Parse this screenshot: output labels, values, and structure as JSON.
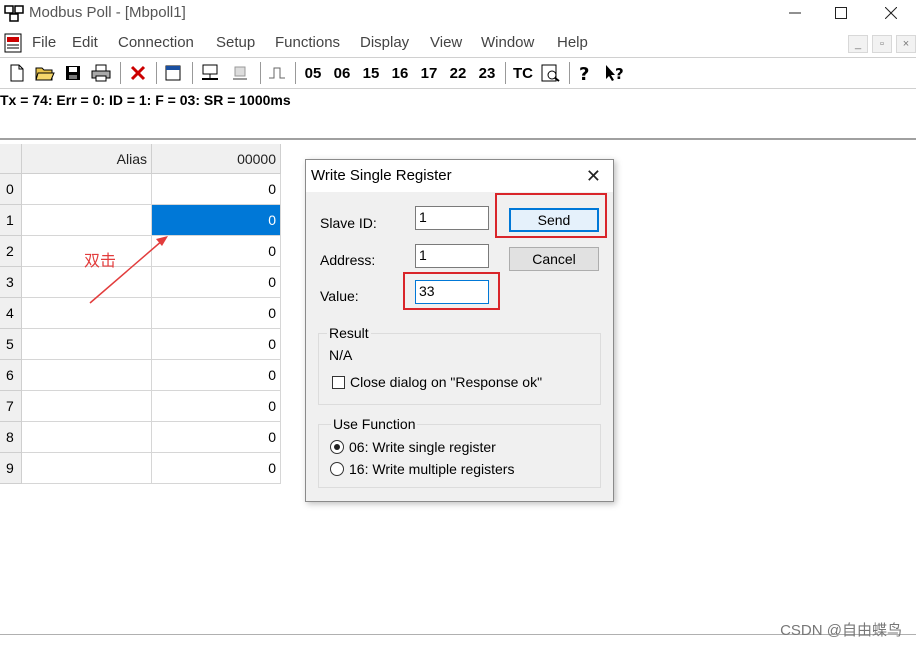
{
  "window": {
    "title": "Modbus Poll - [Mbpoll1]"
  },
  "menu": [
    "File",
    "Edit",
    "Connection",
    "Setup",
    "Functions",
    "Display",
    "View",
    "Window",
    "Help"
  ],
  "toolbar": {
    "function_codes": [
      "05",
      "06",
      "15",
      "16",
      "17",
      "22",
      "23"
    ],
    "tc_label": "TC"
  },
  "status_line": "Tx = 74: Err = 0: ID = 1: F = 03: SR = 1000ms",
  "grid": {
    "headers": {
      "alias": "Alias",
      "address": "00000"
    },
    "rows": [
      {
        "index": "0",
        "alias": "",
        "value": "0"
      },
      {
        "index": "1",
        "alias": "",
        "value": "0"
      },
      {
        "index": "2",
        "alias": "",
        "value": "0"
      },
      {
        "index": "3",
        "alias": "",
        "value": "0"
      },
      {
        "index": "4",
        "alias": "",
        "value": "0"
      },
      {
        "index": "5",
        "alias": "",
        "value": "0"
      },
      {
        "index": "6",
        "alias": "",
        "value": "0"
      },
      {
        "index": "7",
        "alias": "",
        "value": "0"
      },
      {
        "index": "8",
        "alias": "",
        "value": "0"
      },
      {
        "index": "9",
        "alias": "",
        "value": "0"
      }
    ],
    "selected_row": 1
  },
  "annotation": {
    "text": "双击"
  },
  "dialog": {
    "title": "Write Single Register",
    "slave_id_label": "Slave ID:",
    "slave_id_value": "1",
    "address_label": "Address:",
    "address_value": "1",
    "value_label": "Value:",
    "value_value": "33",
    "send_label": "Send",
    "cancel_label": "Cancel",
    "result_title": "Result",
    "result_value": "N/A",
    "close_on_ok_label": "Close dialog on \"Response ok\"",
    "use_function_title": "Use Function",
    "option_06": "06: Write single register",
    "option_16": "16: Write multiple registers"
  },
  "watermark": "CSDN @自由蝶鸟",
  "colors": {
    "selection": "#0078d7",
    "highlight": "#d9252a",
    "annotation": "#e23c3c"
  }
}
